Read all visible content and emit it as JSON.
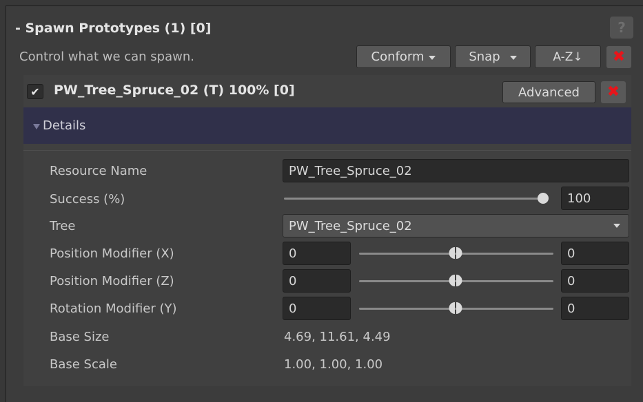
{
  "header": {
    "title": "- Spawn Prototypes (1) [0]",
    "help_glyph": "?",
    "subtitle": "Control what we can spawn."
  },
  "toolbar": {
    "conform_label": "Conform",
    "snap_label": "Snap",
    "sort_label": "A-Z↓",
    "remove_glyph": "✖"
  },
  "prototype": {
    "checked": true,
    "check_glyph": "✔",
    "title": "PW_Tree_Spruce_02 (T) 100% [0]",
    "advanced_label": "Advanced",
    "remove_glyph": "✖"
  },
  "details": {
    "label": "Details"
  },
  "fields": {
    "resource_name": {
      "label": "Resource Name",
      "value": "PW_Tree_Spruce_02"
    },
    "success": {
      "label": "Success (%)",
      "value": "100",
      "fraction": 1.0
    },
    "tree": {
      "label": "Tree",
      "value": "PW_Tree_Spruce_02"
    },
    "position_x": {
      "label": "Position Modifier (X)",
      "min": "0",
      "max": "0"
    },
    "position_z": {
      "label": "Position Modifier (Z)",
      "min": "0",
      "max": "0"
    },
    "rotation_y": {
      "label": "Rotation Modifier (Y)",
      "min": "0",
      "max": "0"
    },
    "base_size": {
      "label": "Base Size",
      "value": "4.69, 11.61, 4.49"
    },
    "base_scale": {
      "label": "Base Scale",
      "value": "1.00, 1.00, 1.00"
    }
  },
  "colors": {
    "accent_red": "#e8141a",
    "details_bar": "#30304a"
  }
}
